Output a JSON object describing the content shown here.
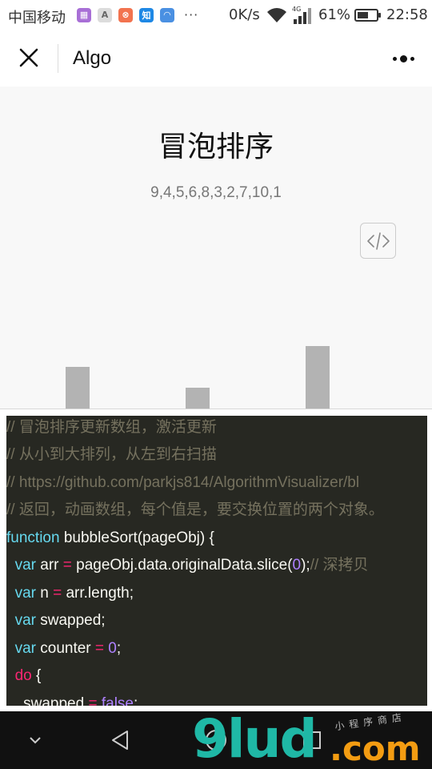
{
  "status_bar": {
    "carrier": "中国移动",
    "network_speed": "0K/s",
    "network_type": "4G",
    "battery_percent": "61%",
    "battery_level": 0.61,
    "time": "22:58",
    "notification_icons": [
      "gallery-icon",
      "font-icon",
      "compass-icon",
      "zhihu-icon",
      "wifi-app-icon"
    ],
    "more_icons": "···"
  },
  "nav": {
    "title": "Algo"
  },
  "page": {
    "title": "冒泡排序",
    "array_text": "9,4,5,6,8,3,2,7,10,1"
  },
  "bars_visible": [
    {
      "value": 4
    },
    {
      "value": 2
    },
    {
      "value": 6
    }
  ],
  "code": {
    "lines": [
      [
        {
          "t": "// 冒泡排序更新数组，激活更新",
          "c": "c-comment"
        }
      ],
      [
        {
          "t": "// 从小到大排列，从左到右扫描",
          "c": "c-comment"
        }
      ],
      [
        {
          "t": "// https://github.com/parkjs814/AlgorithmVisualizer/bl",
          "c": "c-comment"
        }
      ],
      [
        {
          "t": "// 返回，动画数组，每个值是，要交换位置的两个对象。",
          "c": "c-comment"
        }
      ],
      [
        {
          "t": "function",
          "c": "c-kw"
        },
        {
          "t": " bubbleSort(pageObj) {",
          "c": ""
        }
      ],
      [
        {
          "t": "  ",
          "c": ""
        },
        {
          "t": "var",
          "c": "c-kw"
        },
        {
          "t": " arr ",
          "c": ""
        },
        {
          "t": "=",
          "c": "c-op"
        },
        {
          "t": " pageObj.data.originalData.slice(",
          "c": ""
        },
        {
          "t": "0",
          "c": "c-num"
        },
        {
          "t": ");",
          "c": ""
        },
        {
          "t": "// 深拷贝",
          "c": "c-comment"
        }
      ],
      [
        {
          "t": "  ",
          "c": ""
        },
        {
          "t": "var",
          "c": "c-kw"
        },
        {
          "t": " n ",
          "c": ""
        },
        {
          "t": "=",
          "c": "c-op"
        },
        {
          "t": " arr.length;",
          "c": ""
        }
      ],
      [
        {
          "t": "  ",
          "c": ""
        },
        {
          "t": "var",
          "c": "c-kw"
        },
        {
          "t": " swapped;",
          "c": ""
        }
      ],
      [
        {
          "t": "  ",
          "c": ""
        },
        {
          "t": "var",
          "c": "c-kw"
        },
        {
          "t": " counter ",
          "c": ""
        },
        {
          "t": "=",
          "c": "c-op"
        },
        {
          "t": " ",
          "c": ""
        },
        {
          "t": "0",
          "c": "c-num"
        },
        {
          "t": ";",
          "c": ""
        }
      ],
      [
        {
          "t": "  ",
          "c": ""
        },
        {
          "t": "do",
          "c": "c-do"
        },
        {
          "t": " {",
          "c": ""
        }
      ],
      [
        {
          "t": "    swapped ",
          "c": ""
        },
        {
          "t": "=",
          "c": "c-op"
        },
        {
          "t": " ",
          "c": ""
        },
        {
          "t": "false",
          "c": "c-num"
        },
        {
          "t": ";",
          "c": ""
        }
      ]
    ]
  },
  "watermark": {
    "brand": "9lud",
    "suffix": ".com",
    "tagline": "小程序商店"
  },
  "colors": {
    "code_bg": "#272822",
    "bar": "#b3b3b3",
    "content_bg": "#f8f8f8"
  }
}
